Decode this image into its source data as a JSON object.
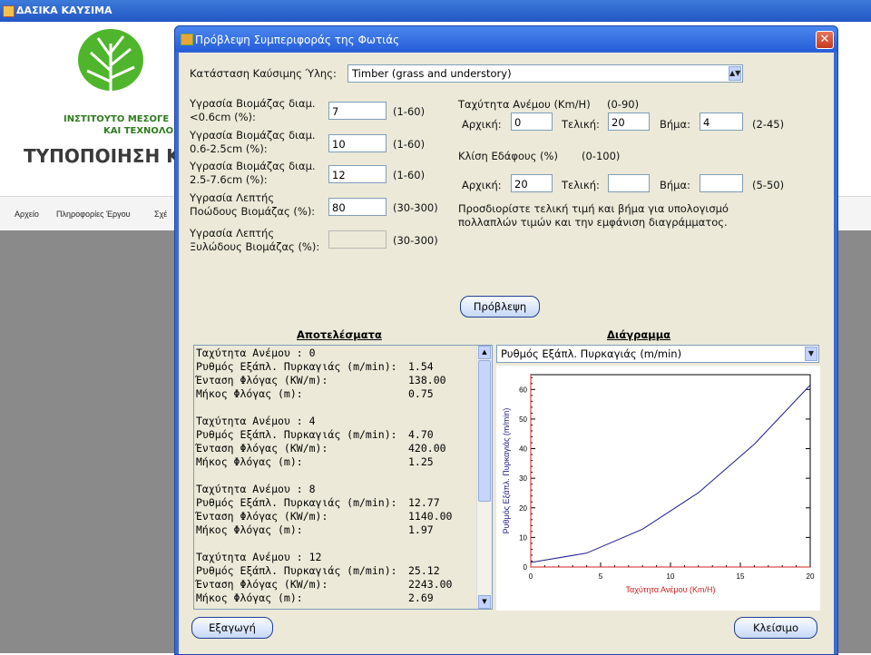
{
  "app": {
    "title": "ΔΑΣΙΚΑ ΚΑΥΣΙΜΑ"
  },
  "header": {
    "org_line1": "ΙΝΣΤΙΤΟΥΤΟ ΜΕΣΟΓΕ",
    "org_line2": "ΚΑΙ ΤΕΧΝΟΛΟ",
    "banner": "ΤΥΠΟΠΟΙΗΣΗ Κ"
  },
  "menu": [
    "Αρχείο",
    "Πληροφορίες Έργου",
    "Σχέ"
  ],
  "dialog": {
    "title": "Πρόβλεψη Συμπεριφοράς της Φωτιάς",
    "close": "✕",
    "fuel_label": "Κατάσταση Καύσιμης Ύλης:",
    "fuel_value": "Timber (grass and understory)",
    "moisture": [
      {
        "label1": "Υγρασία Βιομάζας διαμ.",
        "label2": "<0.6cm (%):",
        "value": "7",
        "range": "(1-60)"
      },
      {
        "label1": "Υγρασία Βιομάζας διαμ.",
        "label2": "0.6-2.5cm (%):",
        "value": "10",
        "range": "(1-60)"
      },
      {
        "label1": "Υγρασία Βιομάζας διαμ.",
        "label2": "2.5-7.6cm (%):",
        "value": "12",
        "range": "(1-60)"
      },
      {
        "label1": "Υγρασία Λεπτής",
        "label2": "Ποώδους Βιομάζας (%):",
        "value": "80",
        "range": "(30-300)"
      },
      {
        "label1": "Υγρασία Λεπτής",
        "label2": "Ξυλώδους Βιομάζας (%):",
        "value": "",
        "range": "(30-300)"
      }
    ],
    "wind": {
      "label": "Ταχύτητα Ανέμου (Km/H)",
      "range": "(0-90)",
      "start_label": "Αρχική:",
      "start": "0",
      "end_label": "Τελική:",
      "end": "20",
      "step_label": "Βήμα:",
      "step": "4",
      "step_range": "(2-45)"
    },
    "slope": {
      "label": "Κλίση Εδάφους (%)",
      "range": "(0-100)",
      "start_label": "Αρχική:",
      "start": "20",
      "end_label": "Τελική:",
      "end": "",
      "step_label": "Βήμα:",
      "step": "",
      "step_range": "(5-50)"
    },
    "hint1": "Προσδιορίστε τελική τιμή και βήμα για υπολογισμό",
    "hint2": "πολλαπλών τιμών και την εμφάνιση διαγράμματος.",
    "predict_button": "Πρόβλεψη",
    "results_title": "Αποτελέσματα",
    "chart_title": "Διάγραμμα",
    "chart_select": "Ρυθμός Εξάπλ. Πυρκαγιάς (m/min)",
    "export_button": "Εξαγωγή",
    "close_button": "Κλείσιμο",
    "results": [
      {
        "wind": "Ταχύτητα Ανέμου : 0",
        "rate_label": "Ρυθμός Εξάπλ. Πυρκαγιάς (m/min):",
        "rate": "1.54",
        "int_label": "Ένταση Φλόγας (KW/m):",
        "int": "138.00",
        "len_label": "Μήκος Φλόγας (m):",
        "len": "0.75"
      },
      {
        "wind": "Ταχύτητα Ανέμου : 4",
        "rate_label": "Ρυθμός Εξάπλ. Πυρκαγιάς (m/min):",
        "rate": "4.70",
        "int_label": "Ένταση Φλόγας (KW/m):",
        "int": "420.00",
        "len_label": "Μήκος Φλόγας (m):",
        "len": "1.25"
      },
      {
        "wind": "Ταχύτητα Ανέμου : 8",
        "rate_label": "Ρυθμός Εξάπλ. Πυρκαγιάς (m/min):",
        "rate": "12.77",
        "int_label": "Ένταση Φλόγας (KW/m):",
        "int": "1140.00",
        "len_label": "Μήκος Φλόγας (m):",
        "len": "1.97"
      },
      {
        "wind": "Ταχύτητα Ανέμου : 12",
        "rate_label": "Ρυθμός Εξάπλ. Πυρκαγιάς (m/min):",
        "rate": "25.12",
        "int_label": "Ένταση Φλόγας (KW/m):",
        "int": "2243.00",
        "len_label": "Μήκος Φλόγας (m):",
        "len": "2.69"
      }
    ]
  },
  "chart_data": {
    "type": "line",
    "xlabel": "Ταχύτητα Ανέμου (Km/H)",
    "ylabel": "Ρυθμός Εξάπλ. Πυρκαγιάς (m/min)",
    "xlim": [
      0,
      20
    ],
    "ylim": [
      0,
      65
    ],
    "xticks": [
      0,
      5,
      10,
      15,
      20
    ],
    "yticks": [
      0,
      10,
      20,
      30,
      40,
      50,
      60
    ],
    "series": [
      {
        "x": [
          0,
          4,
          8,
          12,
          16,
          20
        ],
        "y": [
          1.54,
          4.7,
          12.77,
          25.12,
          41.5,
          61.5
        ],
        "color": "#1c1c8c"
      }
    ],
    "axis_color": "#d02020"
  }
}
